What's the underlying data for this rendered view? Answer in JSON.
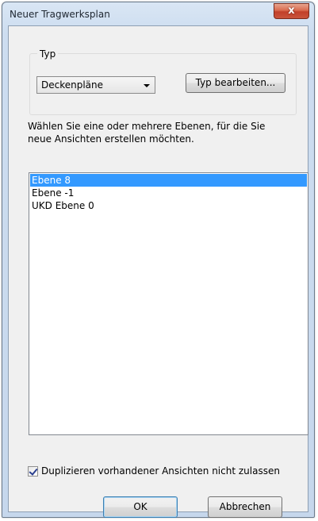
{
  "dialog": {
    "title": "Neuer Tragwerksplan",
    "close_label": "x"
  },
  "type_group": {
    "legend": "Typ",
    "selected_type": "Deckenpläne",
    "edit_button": "Typ bearbeiten..."
  },
  "instruction": "Wählen Sie eine oder mehrere Ebenen, für die Sie neue Ansichten erstellen möchten.",
  "levels": [
    {
      "label": "Ebene 8",
      "selected": true
    },
    {
      "label": "Ebene -1",
      "selected": false
    },
    {
      "label": "UKD Ebene 0",
      "selected": false
    }
  ],
  "options": {
    "no_duplicates_label": "Duplizieren vorhandener Ansichten nicht zulassen",
    "no_duplicates_checked": true
  },
  "buttons": {
    "ok": "OK",
    "cancel": "Abbrechen"
  },
  "colors": {
    "selection": "#3399ff",
    "close_button": "#c9543b"
  }
}
